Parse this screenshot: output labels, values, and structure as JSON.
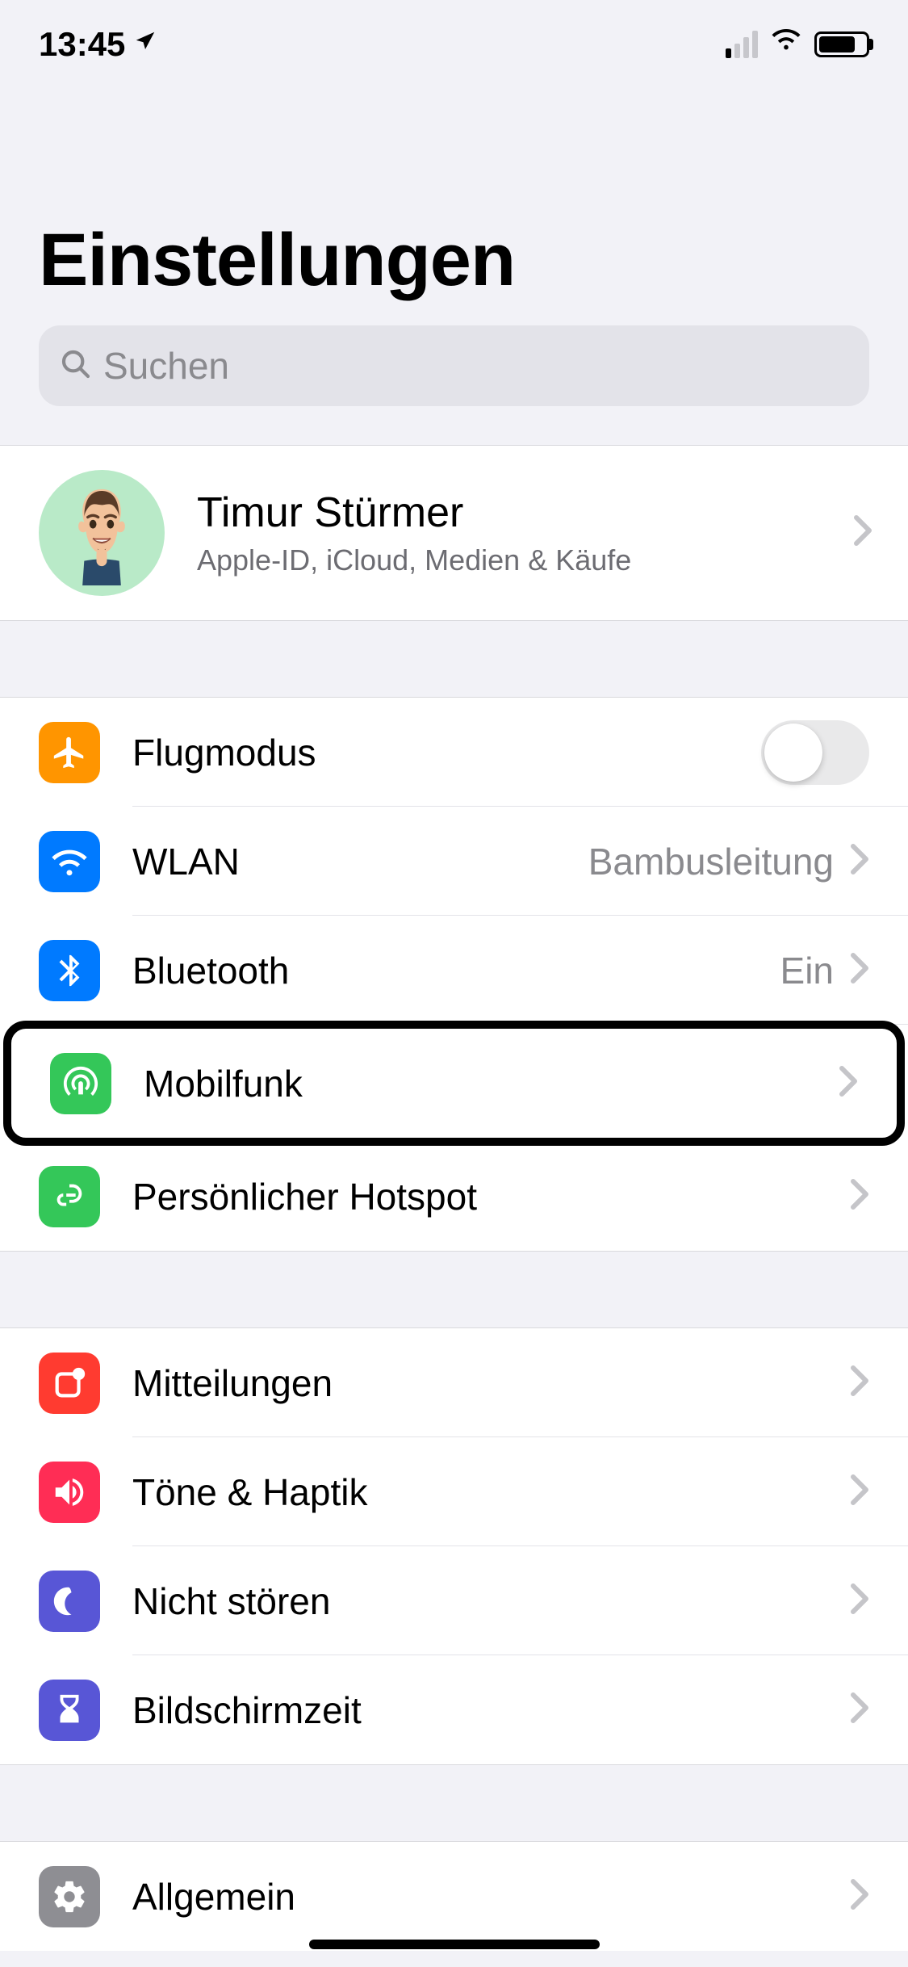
{
  "status_bar": {
    "time": "13:45"
  },
  "header": {
    "title": "Einstellungen",
    "search_placeholder": "Suchen"
  },
  "profile": {
    "name": "Timur Stürmer",
    "sub": "Apple-ID, iCloud, Medien & Käufe"
  },
  "group1": {
    "airplane": "Flugmodus",
    "wlan_label": "WLAN",
    "wlan_value": "Bambusleitung",
    "bluetooth_label": "Bluetooth",
    "bluetooth_value": "Ein",
    "cellular": "Mobilfunk",
    "hotspot": "Persönlicher Hotspot"
  },
  "group2": {
    "notifications": "Mitteilungen",
    "sounds": "Töne & Haptik",
    "dnd": "Nicht stören",
    "screentime": "Bildschirmzeit"
  },
  "group3": {
    "general": "Allgemein"
  }
}
